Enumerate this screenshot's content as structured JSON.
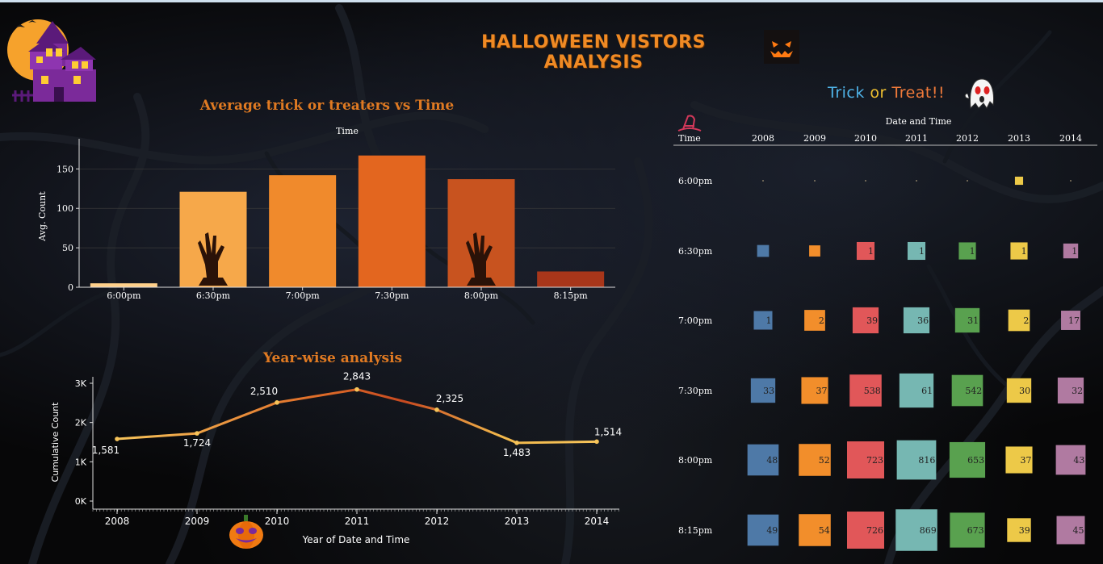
{
  "dashboard": {
    "title": "HALLOWEEN VISTORS ANALYSIS",
    "trick_or_treat": [
      "Trick",
      "or",
      "Treat!!"
    ],
    "icons": [
      "haunted-house-icon",
      "jack-o-lantern-face-icon",
      "ghost-icon",
      "witch-hat-icon",
      "pumpkin-icon",
      "zombie-hand-icon"
    ]
  },
  "colors": {
    "title": "#f08a24",
    "chart_title": "#e07a22",
    "line": "#f2b84b",
    "bars": [
      "#ffd08a",
      "#f6a84a",
      "#f08a2c",
      "#e3661f",
      "#c8531f",
      "#a8361a"
    ],
    "years": [
      "#4e79a7",
      "#f28e2b",
      "#e15759",
      "#76b7b2",
      "#59a14f",
      "#edc948",
      "#b07aa1"
    ]
  },
  "chart_data": [
    {
      "type": "bar",
      "title": "Average trick or treaters vs Time",
      "top_label": "Time",
      "xlabel": "",
      "ylabel": "Avg. Count",
      "categories": [
        "6:00pm",
        "6:30pm",
        "7:00pm",
        "7:30pm",
        "8:00pm",
        "8:15pm"
      ],
      "values": [
        5,
        121,
        142,
        167,
        137,
        20
      ],
      "ylim": [
        0,
        180
      ],
      "yticks": [
        0,
        50,
        100,
        150
      ],
      "grid": true
    },
    {
      "type": "line",
      "title": "Year-wise analysis",
      "xlabel": "Year of Date and Time",
      "ylabel": "Cumulative Count",
      "x": [
        "2008",
        "2009",
        "2010",
        "2011",
        "2012",
        "2013",
        "2014"
      ],
      "values": [
        1581,
        1724,
        2510,
        2843,
        2325,
        1483,
        1514
      ],
      "labels": [
        "1,581",
        "1,724",
        "2,510",
        "2,843",
        "2,325",
        "1,483",
        "1,514"
      ],
      "ylim": [
        0,
        3000
      ],
      "yticks": [
        "0K",
        "1K",
        "2K",
        "3K"
      ],
      "grid": false
    },
    {
      "type": "heatmap",
      "title": "Trick or Treat!!",
      "column_header": "Date and Time",
      "row_header": "Time",
      "columns": [
        "2008",
        "2009",
        "2010",
        "2011",
        "2012",
        "2013",
        "2014"
      ],
      "rows": [
        "6:00pm",
        "6:30pm",
        "7:00pm",
        "7:30pm",
        "8:00pm",
        "8:15pm"
      ],
      "values": [
        [
          0,
          0,
          0,
          0,
          0,
          8,
          0
        ],
        [
          1,
          1,
          1,
          1,
          1,
          1,
          1
        ],
        [
          1,
          2,
          3,
          3,
          3,
          2,
          1
        ],
        [
          33,
          37,
          53,
          61,
          54,
          30,
          32
        ],
        [
          48,
          52,
          72,
          81,
          65,
          37,
          43
        ],
        [
          49,
          54,
          72,
          86,
          67,
          39,
          45
        ]
      ],
      "labels": [
        [
          "",
          "",
          "",
          "",
          "",
          "",
          ""
        ],
        [
          "",
          "",
          "1",
          "1",
          "1",
          "1",
          "1"
        ],
        [
          "1",
          "2",
          "39",
          "36",
          "31",
          "2",
          "17"
        ],
        [
          "33",
          "37",
          "538",
          "61",
          "542",
          "30",
          "32"
        ],
        [
          "48",
          "52",
          "723",
          "816",
          "653",
          "37",
          "43"
        ],
        [
          "49",
          "54",
          "726",
          "869",
          "673",
          "39",
          "45"
        ]
      ],
      "size_scale": [
        [
          0.03,
          0.03,
          0.03,
          0.03,
          0.03,
          0.22,
          0.03
        ],
        [
          0.32,
          0.3,
          0.48,
          0.48,
          0.46,
          0.46,
          0.4
        ],
        [
          0.5,
          0.56,
          0.7,
          0.7,
          0.66,
          0.58,
          0.52
        ],
        [
          0.66,
          0.72,
          0.86,
          0.92,
          0.84,
          0.66,
          0.7
        ],
        [
          0.84,
          0.86,
          1.0,
          1.06,
          0.96,
          0.72,
          0.8
        ],
        [
          0.84,
          0.86,
          1.0,
          1.12,
          0.94,
          0.64,
          0.76
        ]
      ]
    }
  ]
}
